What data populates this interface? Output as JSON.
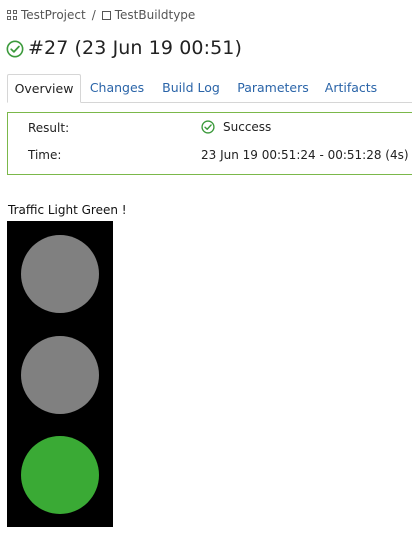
{
  "breadcrumb": {
    "project": "TestProject",
    "separator": "/",
    "buildtype": "TestBuildtype",
    "project_icon": "project-grid-icon",
    "buildtype_icon": "buildtype-square-icon"
  },
  "build": {
    "title": "#27 (23 Jun 19 00:51)",
    "status_icon": "success-check-icon"
  },
  "tabs": [
    {
      "label": "Overview",
      "active": true
    },
    {
      "label": "Changes",
      "active": false
    },
    {
      "label": "Build Log",
      "active": false
    },
    {
      "label": "Parameters",
      "active": false
    },
    {
      "label": "Artifacts",
      "active": false
    }
  ],
  "summary": {
    "result_label": "Result:",
    "result_value": "Success",
    "time_label": "Time:",
    "time_value": "23 Jun 19 00:51:24 - 00:51:28 (4s)"
  },
  "traffic_light": {
    "caption": "Traffic Light Green !",
    "lamps": [
      {
        "state": "off",
        "color": "#808080"
      },
      {
        "state": "off",
        "color": "#808080"
      },
      {
        "state": "on",
        "color": "#3aaa35"
      }
    ]
  },
  "colors": {
    "success": "#3c9a3c",
    "link": "#2a64a8",
    "result_border": "#7bb84a"
  }
}
